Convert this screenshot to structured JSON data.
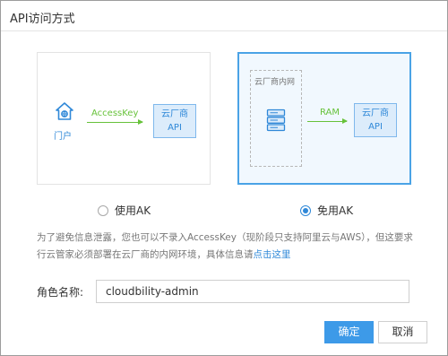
{
  "dialog": {
    "title": "API访问方式"
  },
  "card_ak": {
    "portal_label": "门户",
    "arrow_label": "AccessKey",
    "api_line1": "云厂商",
    "api_line2": "API"
  },
  "card_noak": {
    "intranet_label": "云厂商内网",
    "arrow_label": "RAM",
    "api_line1": "云厂商",
    "api_line2": "API"
  },
  "options": {
    "use_ak": "使用AK",
    "no_ak": "免用AK",
    "selected": "no_ak"
  },
  "note": {
    "text": "为了避免信息泄露，您也可以不录入AccessKey（现阶段只支持阿里云与AWS），但这要求行云管家必须部署在云厂商的内网环境，具体信息请",
    "link": "点击这里"
  },
  "role": {
    "label": "角色名称:",
    "value": "cloudbility-admin"
  },
  "buttons": {
    "ok": "确定",
    "cancel": "取消"
  },
  "colors": {
    "accent": "#2f88d8",
    "primary_button": "#3d9ae8",
    "arrow": "#67c23a",
    "selected_card_bg": "#f1f8fe"
  }
}
